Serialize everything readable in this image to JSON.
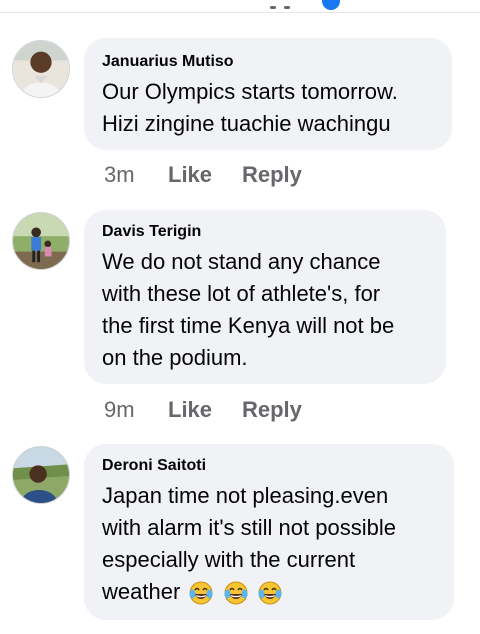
{
  "colors": {
    "bubble_bg": "#f0f2f5",
    "text_primary": "#050505",
    "text_secondary": "#65676b",
    "accent": "#1877f2"
  },
  "comments": [
    {
      "author": "Januarius Mutiso",
      "avatar_icon": "user-avatar-icon",
      "lines": [
        "Our Olympics starts tomorrow.",
        "Hizi zingine tuachie wachingu"
      ],
      "time": "3m",
      "like_label": "Like",
      "reply_label": "Reply"
    },
    {
      "author": "Davis Terigin",
      "avatar_icon": "user-avatar-icon",
      "lines": [
        "We do not stand any chance",
        "with these lot of athlete's, for",
        "the first time Kenya will not be",
        "on the podium."
      ],
      "time": "9m",
      "like_label": "Like",
      "reply_label": "Reply"
    },
    {
      "author": "Deroni Saitoti",
      "avatar_icon": "user-avatar-icon",
      "lines": [
        "Japan time not pleasing.even",
        "with alarm it's still not possible",
        "especially with the current",
        "weather"
      ],
      "emojis": [
        "tears-of-joy-emoji",
        "tears-of-joy-emoji",
        "tears-of-joy-emoji"
      ]
    }
  ]
}
